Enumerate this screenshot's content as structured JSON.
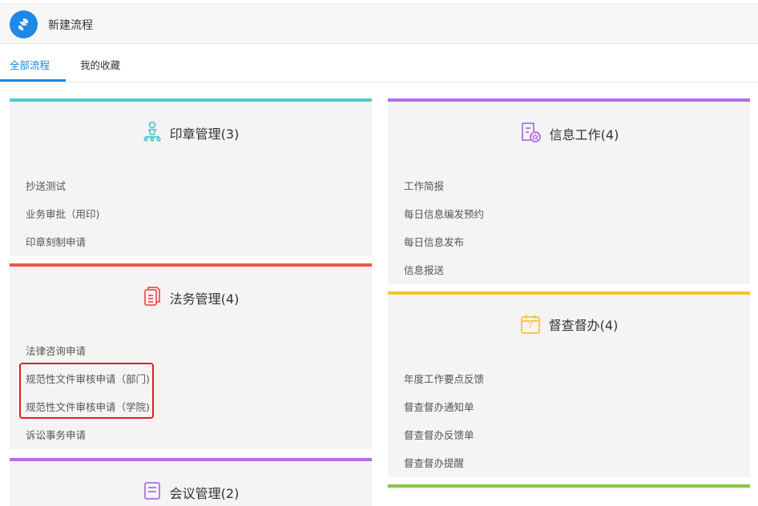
{
  "header": {
    "title": "新建流程"
  },
  "tabs": [
    {
      "label": "全部流程"
    },
    {
      "label": "我的收藏"
    }
  ],
  "colors": {
    "accent": "#1e88e5",
    "teal": "#4ecbc9",
    "red": "#f0554a",
    "purple": "#b06ee6",
    "yellow": "#f5c531",
    "green": "#8cc63e",
    "highlight": "#e0201b"
  },
  "categories": [
    {
      "title": "印章管理(3)",
      "icon": "seal-person-icon",
      "items": [
        "抄送测试",
        "业务审批（用印)",
        "印章刻制申请"
      ]
    },
    {
      "title": "法务管理(4)",
      "icon": "legal-document-icon",
      "items": [
        "法律咨询申请",
        "规范性文件审核申请（部门)",
        "规范性文件审核申请（学院)",
        "诉讼事务申请"
      ]
    },
    {
      "title": "会议管理(2)",
      "icon": "meeting-icon",
      "items": []
    },
    {
      "title": "信息工作(4)",
      "icon": "info-document-icon",
      "items": [
        "工作简报",
        "每日信息编发预约",
        "每日信息发布",
        "信息报送"
      ]
    },
    {
      "title": "督查督办(4)",
      "icon": "calendar-icon",
      "calendar_day": "7",
      "items": [
        "年度工作要点反馈",
        "督查督办通知单",
        "督查督办反馈单",
        "督查督办提醒"
      ]
    }
  ]
}
